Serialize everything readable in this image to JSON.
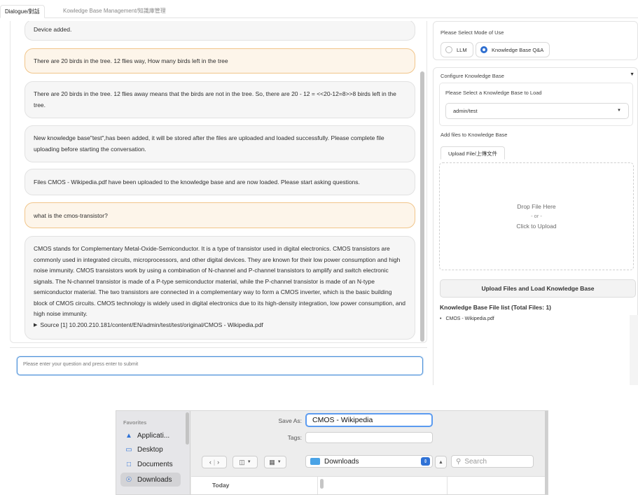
{
  "tabs": {
    "dialogue": "Dialogue/對話",
    "kb_management": "Kowledge Base Management/知識庫管理"
  },
  "chat": {
    "messages": [
      {
        "role": "bot",
        "text": "Device added."
      },
      {
        "role": "user",
        "text": "There are 20 birds in the tree. 12 flies way, How many birds left in the tree"
      },
      {
        "role": "bot",
        "text": "There are 20 birds in the tree. 12 flies away means that the birds are not in the tree. So, there are 20 - 12 = <<20-12=8>>8 birds left in the tree."
      },
      {
        "role": "bot",
        "text": "New knowledge base\"test\",has been added, it will be stored after the files are uploaded and loaded successfully. Please complete file uploading before starting the conversation."
      },
      {
        "role": "bot",
        "text": "Files CMOS - Wikipedia.pdf have been uploaded to the knowledge base and are now loaded. Please start asking questions."
      },
      {
        "role": "user",
        "text": "what is the cmos-transistor?"
      },
      {
        "role": "bot",
        "text": "CMOS stands for Complementary Metal-Oxide-Semiconductor. It is a type of transistor used in digital electronics. CMOS transistors are commonly used in integrated circuits, microprocessors, and other digital devices. They are known for their low power consumption and high noise immunity. CMOS transistors work by using a combination of N-channel and P-channel transistors to amplify and switch electronic signals. The N-channel transistor is made of a P-type semiconductor material, while the P-channel transistor is made of an N-type semiconductor material. The two transistors are connected in a complementary way to form a CMOS inverter, which is the basic building block of CMOS circuits. CMOS technology is widely used in digital electronics due to its high-density integration, low power consumption, and high noise immunity."
      }
    ],
    "source": "Source [1] 10.200.210.181/content/EN/admin/test/test/original/CMOS - Wikipedia.pdf",
    "input_placeholder": "Please enter your question and press enter to submit"
  },
  "right_panel": {
    "mode_label": "Please Select Mode of Use",
    "mode_options": [
      "LLM",
      "Knowledge Base Q&A"
    ],
    "mode_selected": "Knowledge Base Q&A",
    "configure_title": "Configure Knowledge Base",
    "kb_select_label": "Please Select a Knowledge Base to Load",
    "kb_selected": "admin/test",
    "add_files_label": "Add files to Knowledge Base",
    "upload_tab": "Upload File/上傳文件",
    "drop_line1": "Drop File Here",
    "drop_line2": "- or -",
    "drop_line3": "Click to Upload",
    "upload_button": "Upload Files and Load Knowledge Base",
    "file_list_title": "Knowledge Base File list (Total Files: 1)",
    "files": [
      "CMOS - Wikipedia.pdf"
    ]
  },
  "save_dialog": {
    "favorites_title": "Favorites",
    "sidebar": [
      "Applicati...",
      "Desktop",
      "Documents",
      "Downloads"
    ],
    "sidebar_selected": "Downloads",
    "save_as_label": "Save As:",
    "save_as_value": "CMOS - Wikipedia",
    "tags_label": "Tags:",
    "location": "Downloads",
    "search_placeholder": "Search",
    "list_group": "Today"
  },
  "colors": {
    "user_bubble_border": "#f1c58a",
    "user_bubble_bg": "#fdf5ea",
    "accent_blue": "#2f6fd0",
    "folder_blue": "#4aa3e6"
  }
}
